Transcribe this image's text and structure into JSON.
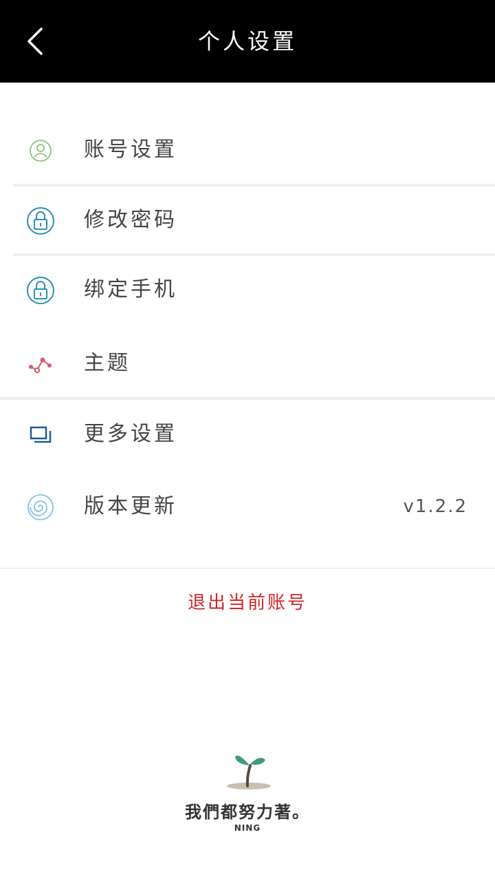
{
  "header": {
    "title": "个人设置",
    "back_icon": "chevron-left-icon"
  },
  "menu": {
    "items": [
      {
        "label": "账号设置",
        "icon": "user-circle-icon",
        "icon_color": "#8cc07a"
      },
      {
        "label": "修改密码",
        "icon": "lock-icon",
        "icon_color": "#2a8fb5"
      },
      {
        "label": "绑定手机",
        "icon": "lock-icon",
        "icon_color": "#2a8fb5"
      },
      {
        "label": "主题",
        "icon": "theme-icon",
        "icon_color": "#d9576b"
      },
      {
        "label": "更多设置",
        "icon": "windows-icon",
        "icon_color": "#1a5e96"
      },
      {
        "label": "版本更新",
        "icon": "swirl-icon",
        "icon_color": "#7fc0e6",
        "value": "v1.2.2"
      }
    ]
  },
  "logout": {
    "label": "退出当前账号",
    "color": "#d22424"
  },
  "footer": {
    "slogan": "我們都努力著。",
    "signature": "NING",
    "image": "sprout-icon"
  }
}
